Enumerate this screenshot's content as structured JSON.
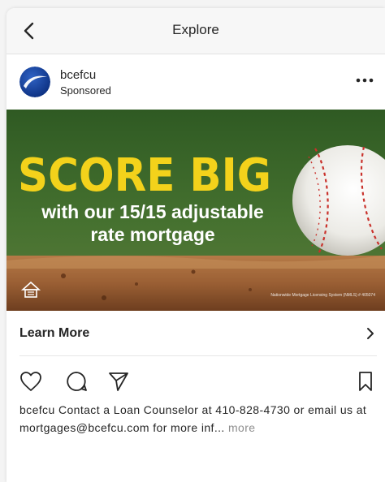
{
  "nav": {
    "title": "Explore"
  },
  "post": {
    "username": "bcefcu",
    "sponsored_label": "Sponsored",
    "ad": {
      "headline": "SCORE BIG",
      "subline_1": "with our 15/15 adjustable",
      "subline_2": "rate mortgage",
      "fine_print": "Nationwide Mortgage Licensing System (NMLS) # 405074",
      "colors": {
        "headline": "#f3d21b",
        "field": "#3f6a2d",
        "dirt": "#a0673b"
      }
    },
    "cta": {
      "label": "Learn More"
    },
    "caption": {
      "username": "bcefcu",
      "text": "Contact a Loan Counselor at 410-828-4730 or email us at mortgages@bcefcu.com for more inf...",
      "more_label": "more"
    }
  },
  "icons": {
    "back": "chevron-left-icon",
    "options": "ellipsis-icon",
    "like": "heart-icon",
    "comment": "comment-bubble-icon",
    "share": "paper-plane-icon",
    "save": "bookmark-icon",
    "cta": "chevron-right-icon",
    "equal_housing": "house-icon"
  }
}
